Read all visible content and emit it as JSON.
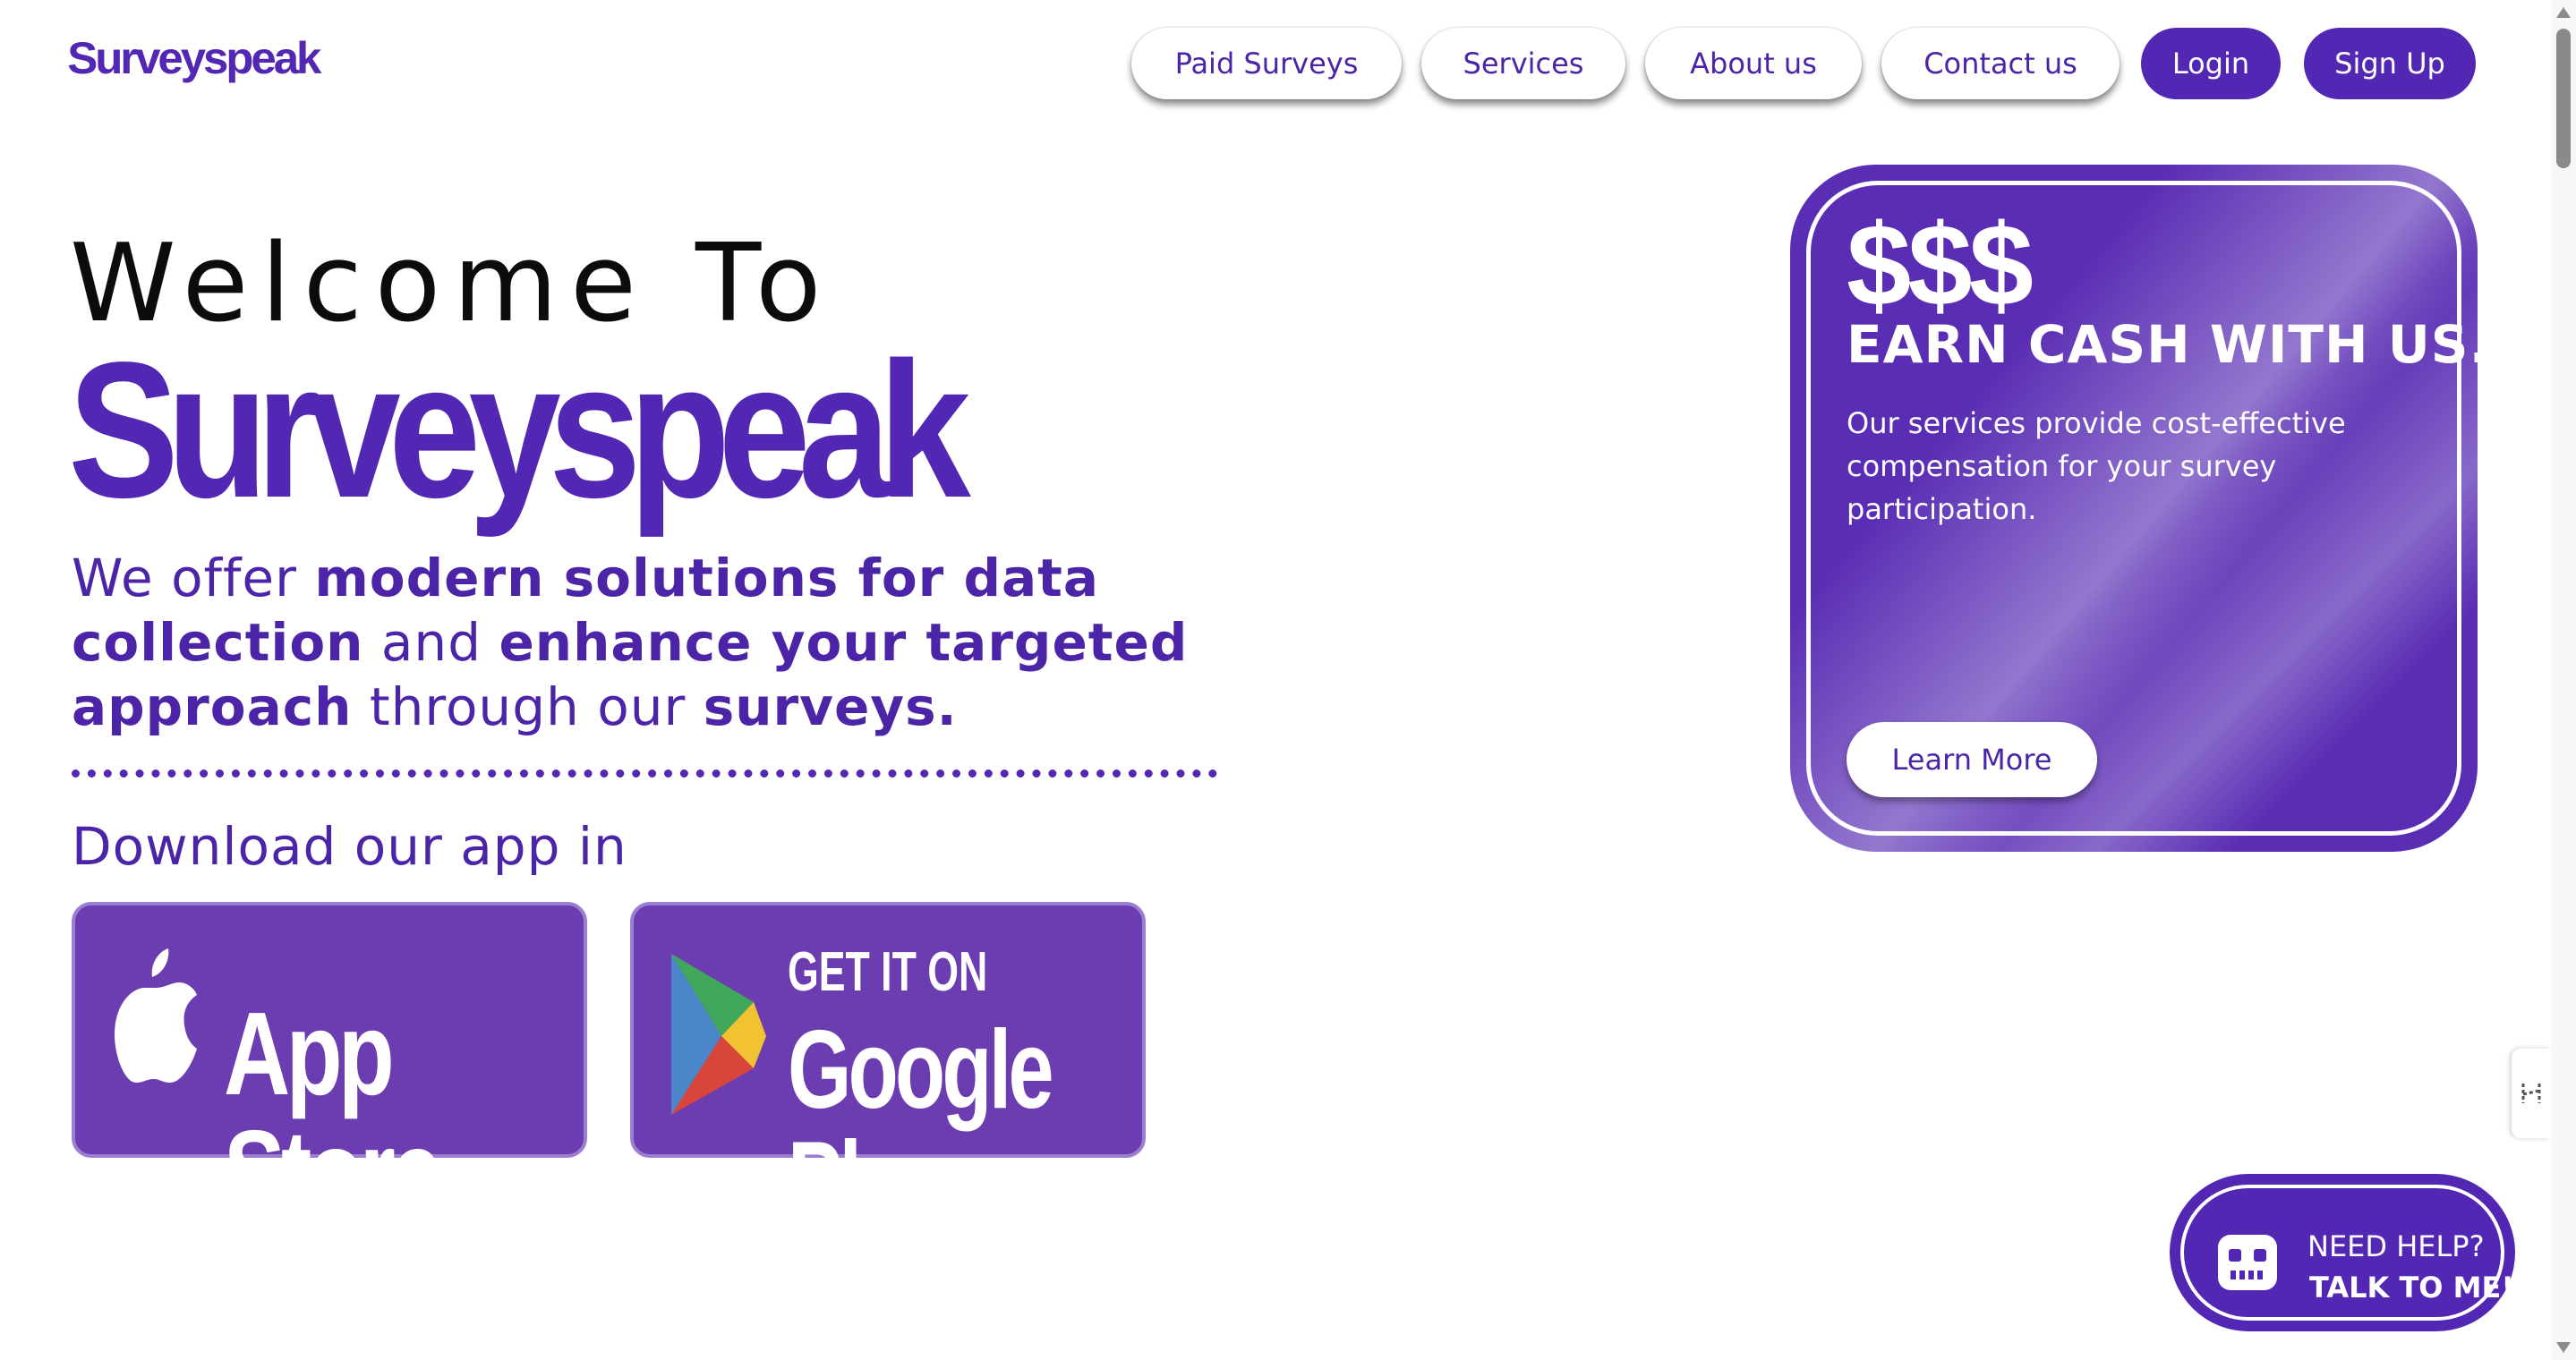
{
  "header": {
    "logo": "Surveyspeak",
    "nav": {
      "paid_surveys": "Paid Surveys",
      "services": "Services",
      "about_us": "About us",
      "contact_us": "Contact us",
      "login": "Login",
      "sign_up": "Sign Up"
    }
  },
  "hero": {
    "welcome": "Welcome To",
    "brand": "Surveyspeak",
    "tagline": {
      "p1": "We offer ",
      "b1": "modern solutions for data collection",
      "p2": " and ",
      "b2": "enhance your targeted approach",
      "p3": " through our ",
      "b3": "surveys."
    },
    "download_label": "Download our app in",
    "app_store": {
      "text": "App Store",
      "icon": "apple-icon"
    },
    "google_play": {
      "small_text": "GET IT ON",
      "text": "Google Play",
      "icon": "google-play-icon"
    }
  },
  "promo_card": {
    "symbol": "$$$",
    "title": "EARN CASH WITH US.",
    "description": "Our services provide cost-effective compensation for your survey participation.",
    "button": "Learn More"
  },
  "help_widget": {
    "line1": "NEED HELP?",
    "line2": "TALK TO ME!",
    "icon": "robot-icon"
  },
  "colors": {
    "brand": "#5227b3",
    "brand_text": "#4b24a8",
    "store_badge": "#6c3db0",
    "card": "#5a2eb4"
  }
}
